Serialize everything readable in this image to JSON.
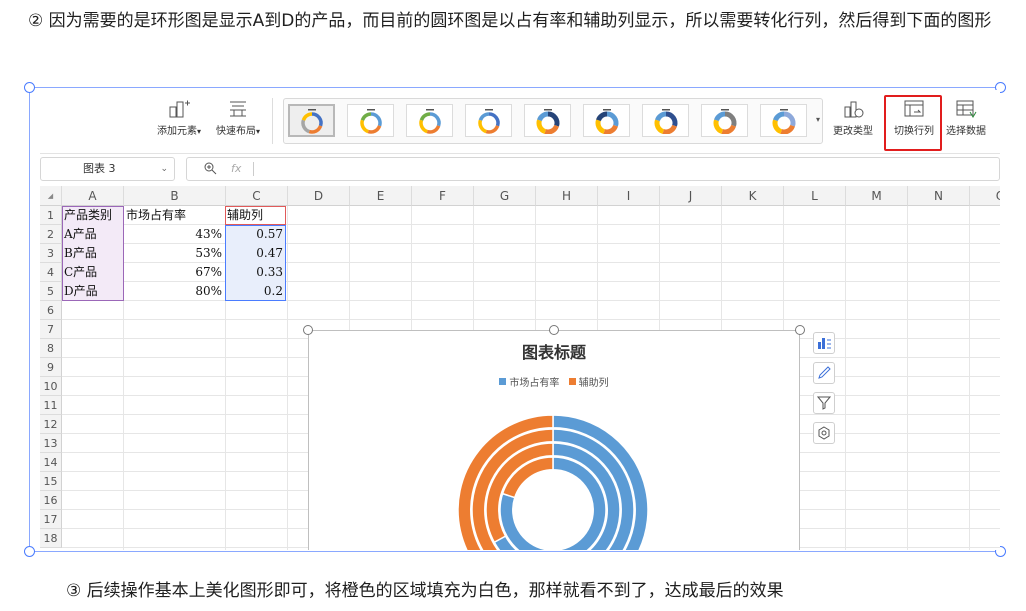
{
  "para1": "② 因为需要的是环形图是显示A到D的产品，而目前的圆环图是以占有率和辅助列显示，所以需要转化行列，然后得到下面的图形",
  "para3": "③ 后续操作基本上美化图形即可，将橙色的区域填充为白色，那样就看不到了，达成最后的效果",
  "ribbon": {
    "add_element": "添加元素",
    "quick_layout": "快速布局",
    "change_type": "更改类型",
    "switch_rowcol": "切换行列",
    "select_data": "选择数据"
  },
  "formula_bar": {
    "name_box": "图表 3",
    "fx": "fx"
  },
  "columns": [
    "A",
    "B",
    "C",
    "D",
    "E",
    "F",
    "G",
    "H",
    "I",
    "J",
    "K",
    "L",
    "M",
    "N",
    "O"
  ],
  "rows": [
    "1",
    "2",
    "3",
    "4",
    "5",
    "6",
    "7",
    "8",
    "9",
    "10",
    "11",
    "12",
    "13",
    "14",
    "15",
    "16",
    "17",
    "18"
  ],
  "table": {
    "headers": [
      "产品类别",
      "市场占有率",
      "辅助列"
    ],
    "rows": [
      [
        "A产品",
        "43%",
        "0.57"
      ],
      [
        "B产品",
        "53%",
        "0.47"
      ],
      [
        "C产品",
        "67%",
        "0.33"
      ],
      [
        "D产品",
        "80%",
        "0.2"
      ]
    ]
  },
  "colors": {
    "blue": "#5b9bd5",
    "orange": "#ed7d31",
    "red_highlight": "#e11d1d",
    "selection": "#4a7cff"
  },
  "chart_data": {
    "type": "doughnut",
    "title": "图表标题",
    "rings": [
      {
        "name": "A产品",
        "values": [
          0.43,
          0.57
        ]
      },
      {
        "name": "B产品",
        "values": [
          0.53,
          0.47
        ]
      },
      {
        "name": "C产品",
        "values": [
          0.67,
          0.33
        ]
      },
      {
        "name": "D产品",
        "values": [
          0.8,
          0.2
        ]
      }
    ],
    "series": [
      {
        "name": "市场占有率",
        "color": "#5b9bd5"
      },
      {
        "name": "辅助列",
        "color": "#ed7d31"
      }
    ],
    "legend": "top"
  }
}
